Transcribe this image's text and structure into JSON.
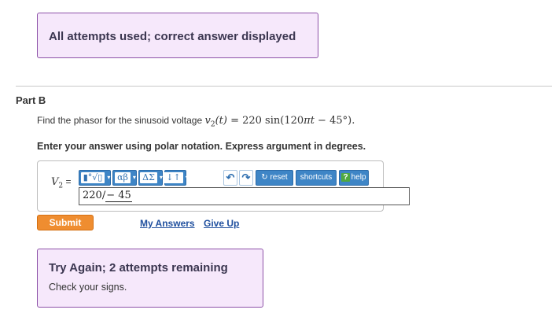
{
  "feedback_top": {
    "text": "All attempts used; correct answer displayed"
  },
  "part": {
    "label": "Part B"
  },
  "question": {
    "prefix": "Find the phasor for the sinusoid voltage ",
    "v": "v",
    "sub": "2",
    "t_arg": "(t)",
    "equals": " = 220 sin(120",
    "pi": "π",
    "t2": "t",
    "tail": " − 45°)."
  },
  "instruction": {
    "text": "Enter your answer using polar notation. Express argument in degrees."
  },
  "answer": {
    "var": "V",
    "sub": "2",
    "eq": "=",
    "value_mag": "220",
    "value_ang": "− 45"
  },
  "toolbar": {
    "templates_label": "▮°√▯",
    "greek_label": "αβ",
    "symbols_label": "ΔΣ",
    "arrows_label": "↓↑",
    "caret": "▾",
    "undo_label": "↶",
    "redo_label": "↷",
    "reset_label": "↻ reset",
    "shortcuts_label": "shortcuts",
    "help_q": "?",
    "help_label": "help"
  },
  "actions": {
    "submit_label": "Submit",
    "my_answers_label": "My Answers",
    "give_up_label": "Give Up"
  },
  "feedback_bottom": {
    "title": "Try Again; 2 attempts remaining",
    "message": "Check your signs."
  },
  "colors": {
    "banner_bg": "#f6e8fb",
    "banner_border": "#8d52a8",
    "toolbar_blue": "#3e85c6",
    "submit_orange": "#ef8d30",
    "link_blue": "#1f4f9e"
  }
}
